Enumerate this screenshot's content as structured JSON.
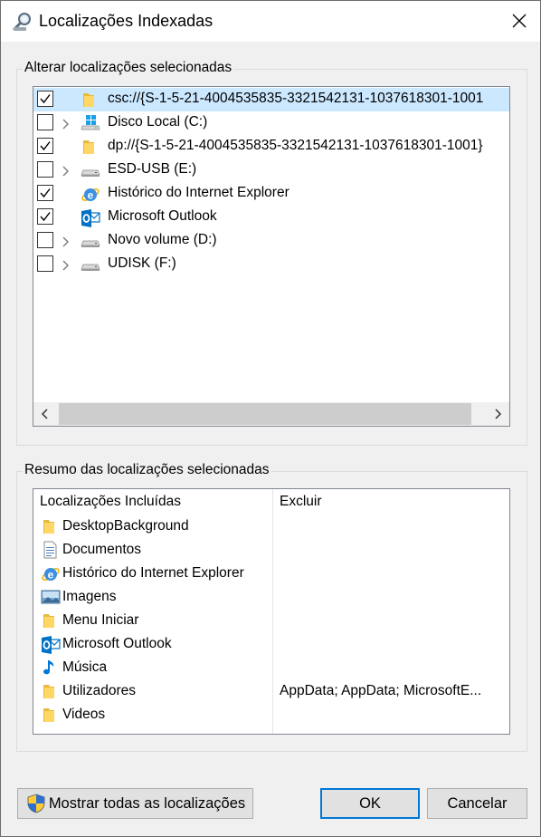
{
  "window": {
    "title": "Localizações Indexadas"
  },
  "icons": {
    "title": "search-magnifier-icon",
    "close": "close-icon",
    "folder": "folder-icon",
    "drive": "drive-icon",
    "ie": "internet-explorer-icon",
    "outlook": "outlook-icon",
    "documents": "documents-icon",
    "pictures": "pictures-icon",
    "music": "music-note-icon",
    "shield": "uac-shield-icon"
  },
  "colors": {
    "accent": "#0078d7",
    "selection": "#cce8ff",
    "folder": "#ffd766"
  },
  "locations_group": {
    "label": "Alterar localizações selecionadas",
    "items": [
      {
        "label": "csc://{S-1-5-21-4004535835-3321542131-1037618301-1001",
        "checked": true,
        "expandable": false,
        "icon": "folder",
        "selected": true
      },
      {
        "label": "Disco Local (C:)",
        "checked": false,
        "expandable": true,
        "icon": "drive-windows"
      },
      {
        "label": "dp://{S-1-5-21-4004535835-3321542131-1037618301-1001}",
        "checked": true,
        "expandable": false,
        "icon": "folder"
      },
      {
        "label": "ESD-USB (E:)",
        "checked": false,
        "expandable": true,
        "icon": "drive"
      },
      {
        "label": "Histórico do Internet Explorer",
        "checked": true,
        "expandable": false,
        "icon": "ie"
      },
      {
        "label": "Microsoft Outlook",
        "checked": true,
        "expandable": false,
        "icon": "outlook"
      },
      {
        "label": "Novo volume (D:)",
        "checked": false,
        "expandable": true,
        "icon": "drive"
      },
      {
        "label": "UDISK (F:)",
        "checked": false,
        "expandable": true,
        "icon": "drive"
      }
    ]
  },
  "summary_group": {
    "label": "Resumo das localizações selecionadas",
    "columns": {
      "included": "Localizações Incluídas",
      "excluded": "Excluir"
    },
    "rows": [
      {
        "label": "DesktopBackground",
        "icon": "folder",
        "exclude": ""
      },
      {
        "label": "Documentos",
        "icon": "documents",
        "exclude": ""
      },
      {
        "label": "Histórico do Internet Explorer",
        "icon": "ie",
        "exclude": ""
      },
      {
        "label": "Imagens",
        "icon": "pictures",
        "exclude": ""
      },
      {
        "label": "Menu Iniciar",
        "icon": "folder",
        "exclude": ""
      },
      {
        "label": "Microsoft Outlook",
        "icon": "outlook",
        "exclude": ""
      },
      {
        "label": "Música",
        "icon": "music",
        "exclude": ""
      },
      {
        "label": "Utilizadores",
        "icon": "folder",
        "exclude": "AppData; AppData; MicrosoftE..."
      },
      {
        "label": "Videos",
        "icon": "folder",
        "exclude": ""
      }
    ]
  },
  "buttons": {
    "show_all": "Mostrar todas as localizações",
    "ok": "OK",
    "cancel": "Cancelar"
  }
}
